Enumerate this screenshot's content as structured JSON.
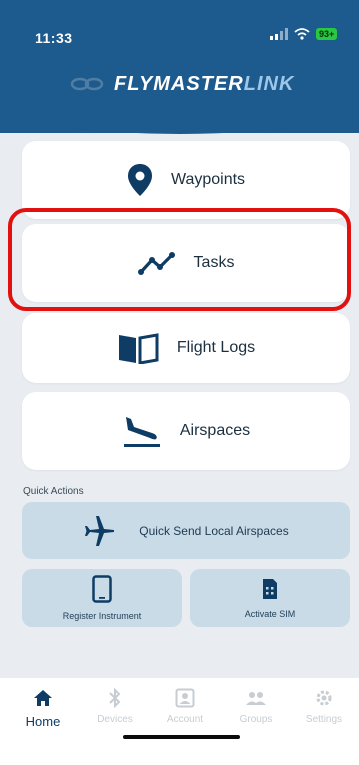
{
  "status_bar": {
    "time": "11:33",
    "battery": "93+"
  },
  "brand": {
    "part1": "FLYMASTER",
    "part2": "LINK"
  },
  "menu": [
    {
      "label": "Waypoints",
      "icon": "location-pin-icon"
    },
    {
      "label": "Tasks",
      "icon": "route-line-icon"
    },
    {
      "label": "Flight Logs",
      "icon": "book-icon"
    },
    {
      "label": "Airspaces",
      "icon": "plane-landing-icon"
    }
  ],
  "quick_actions": {
    "title": "Quick Actions",
    "items": [
      {
        "label": "Quick Send Local Airspaces",
        "icon": "airplane-icon"
      },
      {
        "label": "Register Instrument",
        "icon": "tablet-icon"
      },
      {
        "label": "Activate SIM",
        "icon": "sim-card-icon"
      }
    ]
  },
  "tabs": [
    {
      "label": "Home",
      "icon": "home-icon",
      "active": true
    },
    {
      "label": "Devices",
      "icon": "bluetooth-icon",
      "active": false
    },
    {
      "label": "Account",
      "icon": "account-icon",
      "active": false
    },
    {
      "label": "Groups",
      "icon": "groups-icon",
      "active": false
    },
    {
      "label": "Settings",
      "icon": "gear-icon",
      "active": false
    }
  ],
  "colors": {
    "header": "#1d5a8d",
    "accent": "#0f3c64",
    "highlight": "#e31010",
    "quick_action_bg": "#c9dbe7"
  }
}
